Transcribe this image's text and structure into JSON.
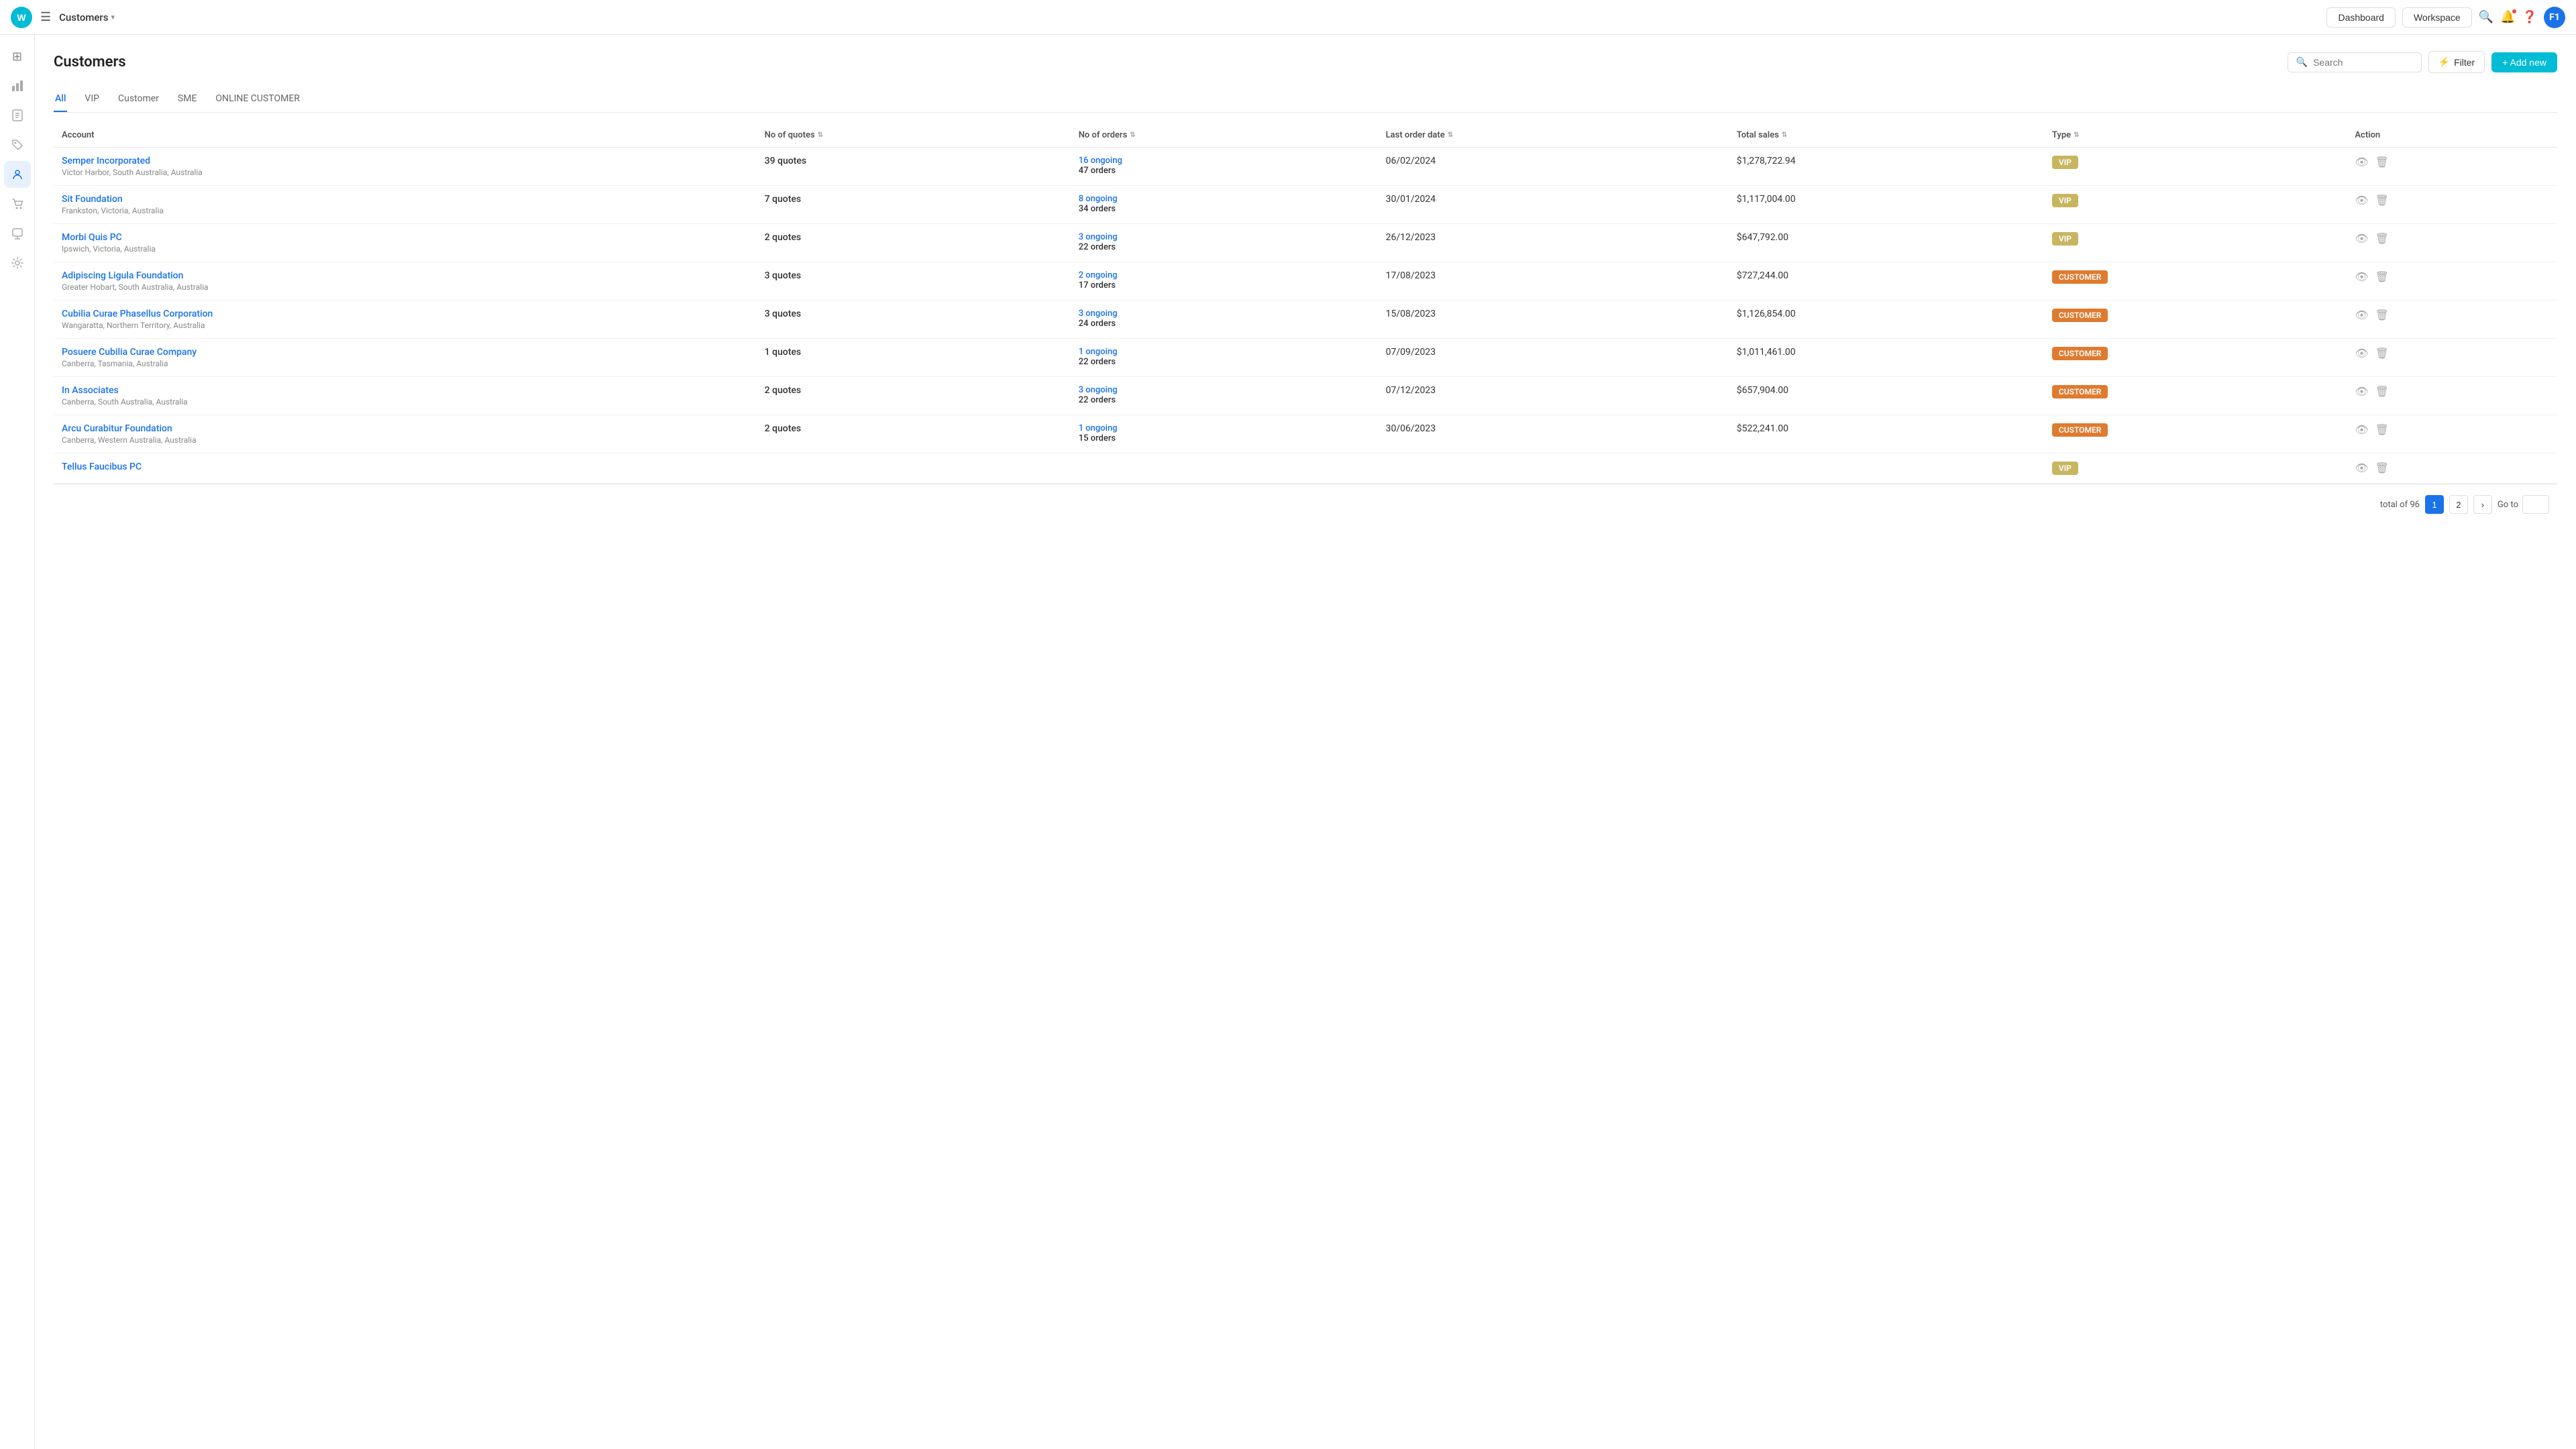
{
  "topnav": {
    "logo_text": "W",
    "breadcrumb": "Customers",
    "dropdown_arrow": "▾",
    "dashboard_label": "Dashboard",
    "workspace_label": "Workspace",
    "avatar_label": "F1"
  },
  "sidebar": {
    "items": [
      {
        "id": "home",
        "icon": "⊞",
        "label": "home-icon"
      },
      {
        "id": "chart",
        "icon": "▦",
        "label": "chart-icon"
      },
      {
        "id": "doc",
        "icon": "☰",
        "label": "doc-icon"
      },
      {
        "id": "tag",
        "icon": "◈",
        "label": "tag-icon"
      },
      {
        "id": "people",
        "icon": "👤",
        "label": "people-icon",
        "active": true
      },
      {
        "id": "cart",
        "icon": "🛒",
        "label": "cart-icon"
      },
      {
        "id": "award",
        "icon": "❑",
        "label": "award-icon"
      },
      {
        "id": "settings",
        "icon": "⚙",
        "label": "settings-icon"
      }
    ]
  },
  "page": {
    "title": "Customers",
    "search_placeholder": "Search",
    "filter_label": "Filter",
    "add_new_label": "+ Add new"
  },
  "tabs": [
    {
      "label": "All",
      "active": true
    },
    {
      "label": "VIP",
      "active": false
    },
    {
      "label": "Customer",
      "active": false
    },
    {
      "label": "SME",
      "active": false
    },
    {
      "label": "ONLINE CUSTOMER",
      "active": false
    }
  ],
  "table": {
    "columns": [
      {
        "label": "Account",
        "sortable": false
      },
      {
        "label": "No of quotes",
        "sortable": true
      },
      {
        "label": "No of orders",
        "sortable": true
      },
      {
        "label": "Last order date",
        "sortable": true
      },
      {
        "label": "Total sales",
        "sortable": true
      },
      {
        "label": "Type",
        "sortable": true
      },
      {
        "label": "Action",
        "sortable": false
      }
    ],
    "rows": [
      {
        "name": "Semper Incorporated",
        "location": "Victor Harbor, South Australia, Australia",
        "quotes": "39 quotes",
        "orders_ongoing": "16 ongoing",
        "orders_total": "47 orders",
        "last_order": "06/02/2024",
        "total_sales": "$1,278,722.94",
        "type": "VIP",
        "type_class": "vip"
      },
      {
        "name": "Sit Foundation",
        "location": "Frankston, Victoria, Australia",
        "quotes": "7 quotes",
        "orders_ongoing": "8 ongoing",
        "orders_total": "34 orders",
        "last_order": "30/01/2024",
        "total_sales": "$1,117,004.00",
        "type": "VIP",
        "type_class": "vip"
      },
      {
        "name": "Morbi Quis PC",
        "location": "Ipswich, Victoria, Australia",
        "quotes": "2 quotes",
        "orders_ongoing": "3 ongoing",
        "orders_total": "22 orders",
        "last_order": "26/12/2023",
        "total_sales": "$647,792.00",
        "type": "VIP",
        "type_class": "vip"
      },
      {
        "name": "Adipiscing Ligula Foundation",
        "location": "Greater Hobart, South Australia, Australia",
        "quotes": "3 quotes",
        "orders_ongoing": "2 ongoing",
        "orders_total": "17 orders",
        "last_order": "17/08/2023",
        "total_sales": "$727,244.00",
        "type": "CUSTOMER",
        "type_class": "customer"
      },
      {
        "name": "Cubilia Curae Phasellus Corporation",
        "location": "Wangaratta, Northern Territory, Australia",
        "quotes": "3 quotes",
        "orders_ongoing": "3 ongoing",
        "orders_total": "24 orders",
        "last_order": "15/08/2023",
        "total_sales": "$1,126,854.00",
        "type": "CUSTOMER",
        "type_class": "customer"
      },
      {
        "name": "Posuere Cubilia Curae Company",
        "location": "Canberra, Tasmania, Australia",
        "quotes": "1 quotes",
        "orders_ongoing": "1 ongoing",
        "orders_total": "22 orders",
        "last_order": "07/09/2023",
        "total_sales": "$1,011,461.00",
        "type": "CUSTOMER",
        "type_class": "customer"
      },
      {
        "name": "In Associates",
        "location": "Canberra, South Australia, Australia",
        "quotes": "2 quotes",
        "orders_ongoing": "3 ongoing",
        "orders_total": "22 orders",
        "last_order": "07/12/2023",
        "total_sales": "$657,904.00",
        "type": "CUSTOMER",
        "type_class": "customer"
      },
      {
        "name": "Arcu Curabitur Foundation",
        "location": "Canberra, Western Australia, Australia",
        "quotes": "2 quotes",
        "orders_ongoing": "1 ongoing",
        "orders_total": "15 orders",
        "last_order": "30/06/2023",
        "total_sales": "$522,241.00",
        "type": "CUSTOMER",
        "type_class": "customer"
      },
      {
        "name": "Tellus Faucibus PC",
        "location": "",
        "quotes": "",
        "orders_ongoing": "",
        "orders_total": "",
        "last_order": "",
        "total_sales": "",
        "type": "VIP",
        "type_class": "vip"
      }
    ]
  },
  "pagination": {
    "total_label": "total of 96",
    "current_page": 1,
    "next_page": 2,
    "goto_label": "Go to"
  }
}
